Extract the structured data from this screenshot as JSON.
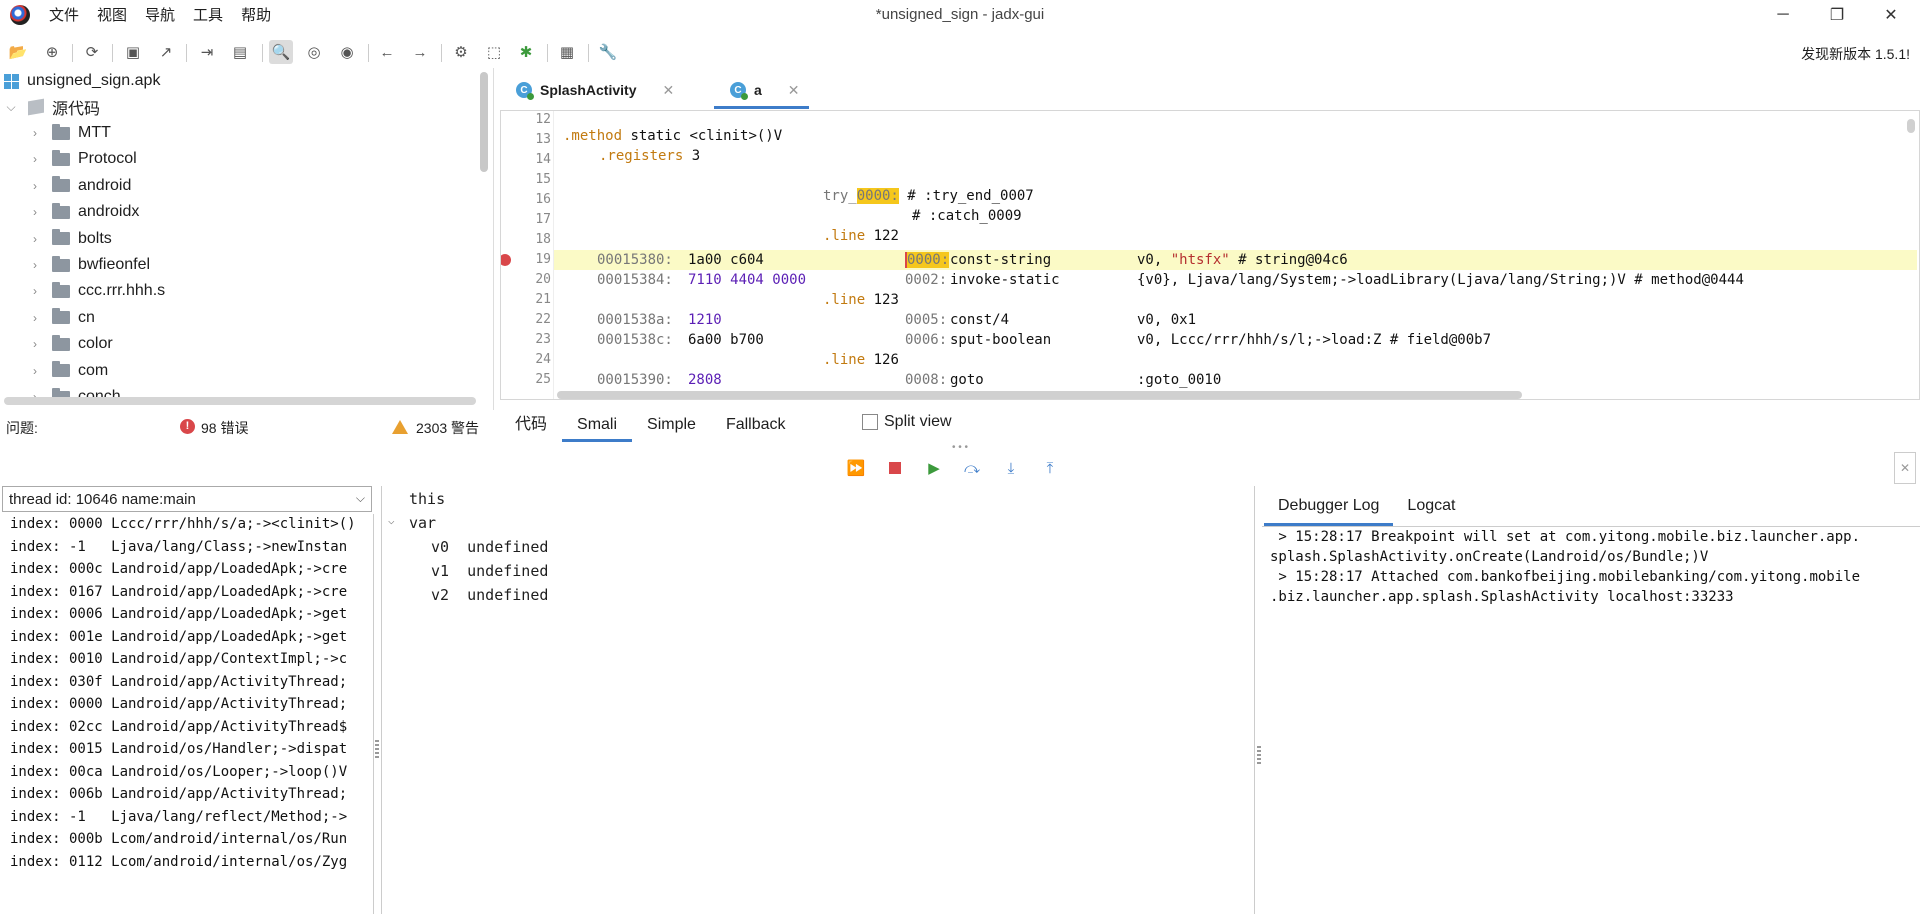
{
  "window": {
    "title": "*unsigned_sign - jadx-gui",
    "min_icon": "minimize-icon",
    "max_icon": "maximize-icon",
    "close_icon": "close-icon"
  },
  "menu": [
    "文件",
    "视图",
    "导航",
    "工具",
    "帮助"
  ],
  "update_notice": "发现新版本 1.5.1!",
  "tree": {
    "root": "unsigned_sign.apk",
    "source": "源代码",
    "packages": [
      "MTT",
      "Protocol",
      "android",
      "androidx",
      "bolts",
      "bwfieonfel",
      "ccc.rrr.hhh.s",
      "cn",
      "color",
      "com",
      "conch"
    ]
  },
  "editor": {
    "tabs": [
      {
        "label": "SplashActivity",
        "icon": "C"
      },
      {
        "label": "a",
        "icon": "C"
      }
    ],
    "lines": [
      {
        "n": "12"
      },
      {
        "n": "13"
      },
      {
        "n": "14"
      },
      {
        "n": "15"
      },
      {
        "n": "16"
      },
      {
        "n": "17"
      },
      {
        "n": "18"
      },
      {
        "n": "19"
      },
      {
        "n": "20"
      },
      {
        "n": "21"
      },
      {
        "n": "22"
      },
      {
        "n": "23"
      },
      {
        "n": "24"
      },
      {
        "n": "25"
      }
    ],
    "code": {
      "l13a": ".method",
      "l13b": " static <clinit>()V",
      "l14a": ".registers",
      "l14b": " 3",
      "l16a": "try_",
      "l16b": "0000:",
      "l16c": " # :try_end_0007",
      "l17": "# :catch_0009",
      "l18a": ".line",
      "l18b": " 122",
      "l19addr": "00015380:",
      "l19hex": "1a00 c604",
      "l19off": "0000:",
      "l19op": "const-string",
      "l19arg1": "v0, ",
      "l19str": "\"htsfx\"",
      "l19arg2": " # string@04c6",
      "l20addr": "00015384:",
      "l20hex": "7110 4404 0000",
      "l20off": "0002:",
      "l20op": "invoke-static",
      "l20arg": "{v0}, Ljava/lang/System;->loadLibrary(Ljava/lang/String;)V # method@0444",
      "l21a": ".line",
      "l21b": " 123",
      "l22addr": "0001538a:",
      "l22hex": "1210",
      "l22off": "0005:",
      "l22op": "const/4",
      "l22arg": "v0, 0x1",
      "l23addr": "0001538c:",
      "l23hex": "6a00 b700",
      "l23off": "0006:",
      "l23op": "sput-boolean",
      "l23arg": "v0, Lccc/rrr/hhh/s/l;->load:Z # field@00b7",
      "l24a": ".line",
      "l24b": " 126",
      "l25addr": "00015390:",
      "l25hex": "2808",
      "l25off": "0008:",
      "l25op": "goto",
      "l25arg": ":goto_0010"
    }
  },
  "status": {
    "issues_label": "问题:",
    "errors": "98 错误",
    "warnings": "2303 警告"
  },
  "view_modes": [
    "代码",
    "Smali",
    "Simple",
    "Fallback"
  ],
  "view_mode_selected": "Smali",
  "split_view": "Split view",
  "thread": "thread id: 10646 name:main",
  "stack": [
    "index: 0000 Lccc/rrr/hhh/s/a;-><clinit>()",
    "index: -1   Ljava/lang/Class;->newInstan",
    "index: 000c Landroid/app/LoadedApk;->cre",
    "index: 0167 Landroid/app/LoadedApk;->cre",
    "index: 0006 Landroid/app/LoadedApk;->get",
    "index: 001e Landroid/app/LoadedApk;->get",
    "index: 0010 Landroid/app/ContextImpl;->c",
    "index: 030f Landroid/app/ActivityThread;",
    "index: 0000 Landroid/app/ActivityThread;",
    "index: 02cc Landroid/app/ActivityThread$",
    "index: 0015 Landroid/os/Handler;->dispat",
    "index: 00ca Landroid/os/Looper;->loop()V",
    "index: 006b Landroid/app/ActivityThread;",
    "index: -1   Ljava/lang/reflect/Method;->",
    "index: 000b Lcom/android/internal/os/Run",
    "index: 0112 Lcom/android/internal/os/Zyg"
  ],
  "vars": {
    "this": "this",
    "var": "var",
    "items": [
      {
        "name": "v0",
        "value": "undefined"
      },
      {
        "name": "v1",
        "value": "undefined"
      },
      {
        "name": "v2",
        "value": "undefined"
      }
    ]
  },
  "log_tabs": [
    "Debugger Log",
    "Logcat"
  ],
  "log": [
    " > 15:28:17 Breakpoint will set at com.yitong.mobile.biz.launcher.app.",
    "splash.SplashActivity.onCreate(Landroid/os/Bundle;)V",
    " > 15:28:17 Attached com.bankofbeijing.mobilebanking/com.yitong.mobile",
    ".biz.launcher.app.splash.SplashActivity localhost:33233"
  ],
  "colors": {
    "accent": "#3d7cc9",
    "highlight_line": "#fbfac6",
    "breakpoint": "#d9474a",
    "keyword": "#c27a10",
    "string": "#b52f2f",
    "number": "#5b1fb5"
  }
}
